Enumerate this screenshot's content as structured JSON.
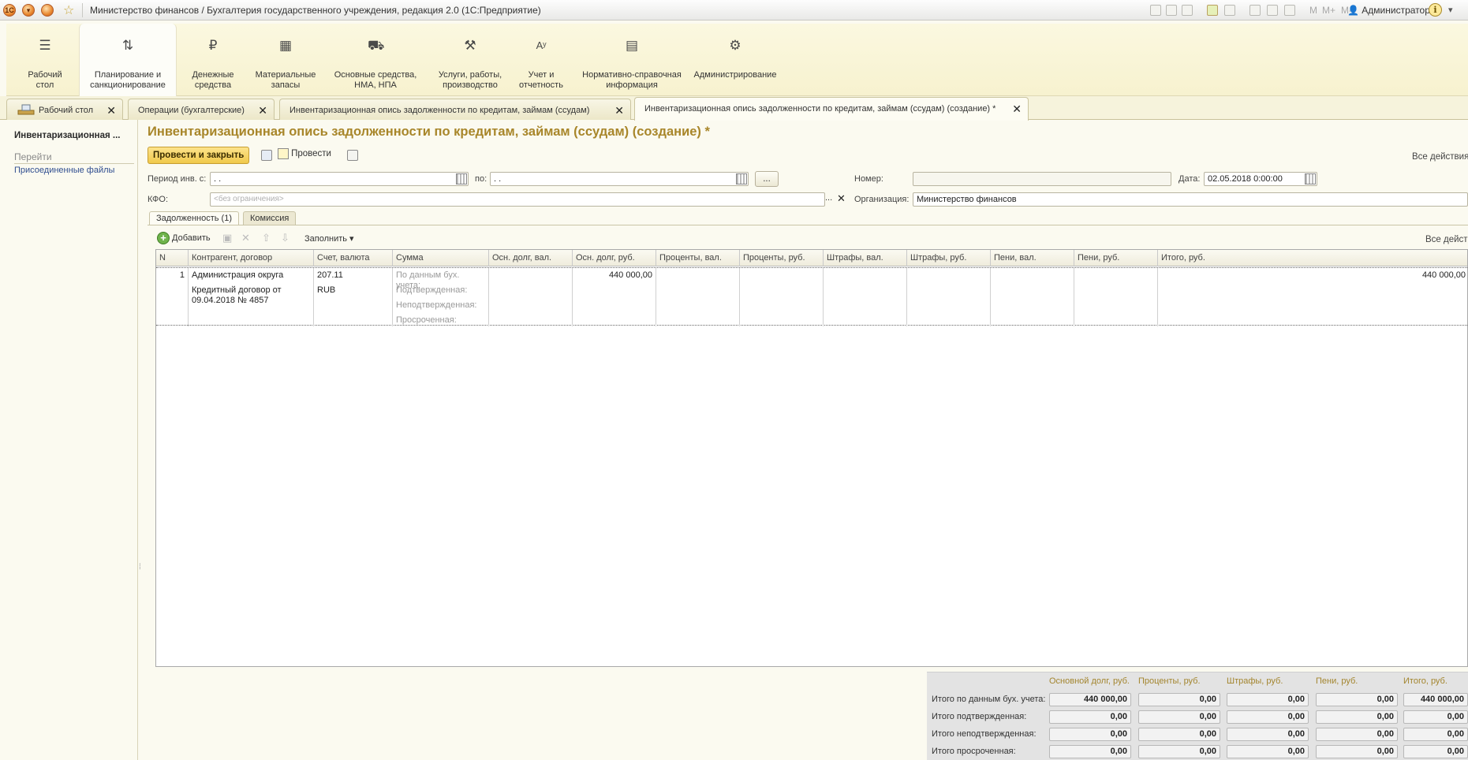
{
  "titlebar": {
    "title": "Министерство финансов / Бухгалтерия государственного учреждения, редакция 2.0  (1С:Предприятие)",
    "mem": [
      "M",
      "M+",
      "M-"
    ],
    "user": "Администратор",
    "info": "i",
    "menu": "▾",
    "logo": "1C"
  },
  "sections": [
    {
      "label1": "Рабочий",
      "label2": "стол",
      "icon": "☰"
    },
    {
      "label1": "Планирование и",
      "label2": "санкционирование",
      "icon": "⇅"
    },
    {
      "label1": "Денежные",
      "label2": "средства",
      "icon": "₽"
    },
    {
      "label1": "Материальные",
      "label2": "запасы",
      "icon": "▦"
    },
    {
      "label1": "Основные средства,",
      "label2": "НМА, НПА",
      "icon": "⛟"
    },
    {
      "label1": "Услуги, работы,",
      "label2": "производство",
      "icon": "⚒"
    },
    {
      "label1": "Учет и",
      "label2": "отчетность",
      "icon": "Aʸ"
    },
    {
      "label1": "Нормативно-справочная",
      "label2": "информация",
      "icon": "▤"
    },
    {
      "label1": "Администрирование",
      "label2": "",
      "icon": "⚙"
    }
  ],
  "tabs": [
    {
      "label": "Рабочий стол"
    },
    {
      "label": "Операции (бухгалтерские)"
    },
    {
      "label": "Инвентаризационная опись задолженности по кредитам, займам (ссудам)"
    },
    {
      "label": "Инвентаризационная опись задолженности по кредитам, займам (ссудам) (создание) *"
    }
  ],
  "close_glyph": "✕",
  "leftnav": {
    "title": "Инвентаризационная ...",
    "group": "Перейти",
    "item": "Присоединенные файлы",
    "grip": "⁞"
  },
  "doc": {
    "title": "Инвентаризационная опись задолженности по кредитам, займам (ссудам) (создание) *",
    "btn_post_close": "Провести и закрыть",
    "btn_post": "Провести",
    "all_actions": "Все действия ▾",
    "all_actions_table": "Все действия ▾",
    "period_label": "Период инв. с:",
    "period_from": " .  .",
    "to_label": "по:",
    "period_to": " .  .",
    "dots": "...",
    "number_label": "Номер:",
    "number_value": "",
    "date_label": "Дата:",
    "date_value": "02.05.2018  0:00:00",
    "kfo_label": "КФО:",
    "kfo_placeholder": "<без ограничения>",
    "org_label": "Организация:",
    "org_value": "Министерство финансов",
    "clear_glyph": "✕"
  },
  "page_tabs": [
    "Задолженность (1)",
    "Комиссия"
  ],
  "table_toolbar": {
    "add": "Добавить",
    "fill": "Заполнить ▾",
    "copy": "▣",
    "delete": "✕",
    "up": "⇧",
    "down": "⇩"
  },
  "table": {
    "columns": [
      "N",
      "Контрагент, договор",
      "Счет, валюта",
      "Сумма",
      "Осн. долг, вал.",
      "Осн. долг, руб.",
      "Проценты, вал.",
      "Проценты, руб.",
      "Штрафы, вал.",
      "Штрафы, руб.",
      "Пени, вал.",
      "Пени, руб.",
      "Итого, руб."
    ],
    "row": {
      "n": "1",
      "counterparty": "Администрация округа",
      "contract": "Кредитный договор от 09.04.2018 № 4857",
      "account": "207.11",
      "currency": "RUB",
      "sum_labels": [
        "По данным бух. учета:",
        "Подтвержденная:",
        "Неподтвержденная:",
        "Просроченная:"
      ],
      "main_debt_rub": "440 000,00",
      "total_rub": "440 000,00"
    }
  },
  "totals": {
    "headers": [
      "Основной долг, руб.",
      "Проценты, руб.",
      "Штрафы, руб.",
      "Пени, руб.",
      "Итого, руб."
    ],
    "rows": [
      {
        "label": "Итого по данным бух. учета:",
        "values": [
          "440 000,00",
          "0,00",
          "0,00",
          "0,00",
          "440 000,00"
        ]
      },
      {
        "label": "Итого подтвержденная:",
        "values": [
          "0,00",
          "0,00",
          "0,00",
          "0,00",
          "0,00"
        ]
      },
      {
        "label": "Итого неподтвержденная:",
        "values": [
          "0,00",
          "0,00",
          "0,00",
          "0,00",
          "0,00"
        ]
      },
      {
        "label": "Итого просроченная:",
        "values": [
          "0,00",
          "0,00",
          "0,00",
          "0,00",
          "0,00"
        ]
      }
    ]
  }
}
